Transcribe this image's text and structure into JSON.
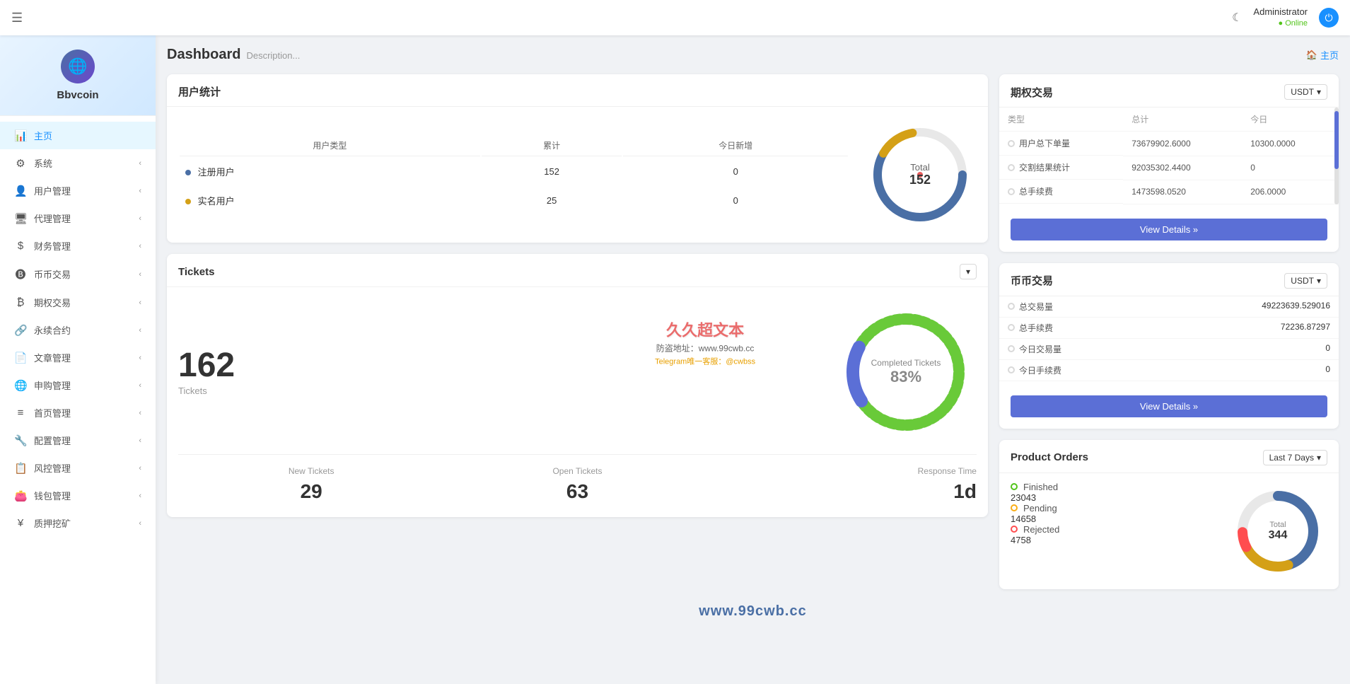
{
  "header": {
    "hamburger": "☰",
    "moon": "☾",
    "admin_name": "Administrator",
    "admin_status": "Online",
    "home_link": "主页"
  },
  "sidebar": {
    "logo_text": "Bbvcoin",
    "items": [
      {
        "icon": "📊",
        "label": "主页",
        "arrow": true,
        "active": true
      },
      {
        "icon": "⚙️",
        "label": "系统",
        "arrow": true
      },
      {
        "icon": "👤",
        "label": "用户管理",
        "arrow": true
      },
      {
        "icon": "🖥️",
        "label": "代理管理",
        "arrow": true
      },
      {
        "icon": "💵",
        "label": "财务管理",
        "arrow": true
      },
      {
        "icon": "🅱",
        "label": "币币交易",
        "arrow": true
      },
      {
        "icon": "₿",
        "label": "期权交易",
        "arrow": true
      },
      {
        "icon": "🔗",
        "label": "永续合约",
        "arrow": true
      },
      {
        "icon": "📄",
        "label": "文章管理",
        "arrow": true
      },
      {
        "icon": "🌐",
        "label": "申购管理",
        "arrow": true
      },
      {
        "icon": "☰",
        "label": "首页管理",
        "arrow": true
      },
      {
        "icon": "🔧",
        "label": "配置管理",
        "arrow": true
      },
      {
        "icon": "📋",
        "label": "风控管理",
        "arrow": true
      },
      {
        "icon": "👛",
        "label": "钱包管理",
        "arrow": true
      },
      {
        "icon": "¥",
        "label": "质押挖矿",
        "arrow": true
      }
    ]
  },
  "page": {
    "title": "Dashboard",
    "description": "Description...",
    "home_link": "主页"
  },
  "user_stats": {
    "title": "用户统计",
    "headers": [
      "用户类型",
      "累计",
      "今日新增"
    ],
    "rows": [
      {
        "label": "注册用户",
        "dot": "blue",
        "total": "152",
        "today": "0"
      },
      {
        "label": "实名用户",
        "dot": "gold",
        "total": "25",
        "today": "0"
      }
    ],
    "donut": {
      "total_label": "Total",
      "total_value": "152"
    }
  },
  "tickets": {
    "title": "Tickets",
    "count": "162",
    "count_label": "Tickets",
    "center_label": "Completed Tickets",
    "center_pct": "83%",
    "dropdown": "▾",
    "stats": [
      {
        "label": "New Tickets",
        "value": "29"
      },
      {
        "label": "Open Tickets",
        "value": "63"
      },
      {
        "label": "Response Time",
        "value": "1d"
      }
    ]
  },
  "options_trading": {
    "title": "期权交易",
    "select": "USDT",
    "headers": [
      "类型",
      "总计",
      "今日"
    ],
    "rows": [
      {
        "label": "用户总下单量",
        "val1": "73679902.6000",
        "val2": "10300.0000"
      },
      {
        "label": "交割结果统计",
        "val1": "92035302.4400",
        "val2": "0"
      },
      {
        "label": "总手续费",
        "val1": "1473598.0520",
        "val2": "206.0000"
      }
    ],
    "view_details": "View Details »"
  },
  "coin_trading": {
    "title": "币币交易",
    "select": "USDT",
    "rows": [
      {
        "label": "总交易量",
        "value": "49223639.529016"
      },
      {
        "label": "总手续费",
        "value": "72236.87297"
      },
      {
        "label": "今日交易量",
        "value": "0"
      },
      {
        "label": "今日手续费",
        "value": "0"
      }
    ],
    "view_details": "View Details »"
  },
  "product_orders": {
    "title": "Product Orders",
    "filter": "Last 7 Days",
    "rows": [
      {
        "label": "Finished",
        "value": "23043",
        "color": "green"
      },
      {
        "label": "Pending",
        "value": "14658",
        "color": "gold"
      },
      {
        "label": "Rejected",
        "value": "4758",
        "color": "red"
      }
    ],
    "donut": {
      "total_label": "Total",
      "total_value": "344"
    }
  },
  "watermark": {
    "main": "久久超文本",
    "url_label": "防盗地址：www.99cwb.cc",
    "tg": "Telegram唯一客服：@cwbss",
    "bottom": "www.99cwb.cc"
  }
}
